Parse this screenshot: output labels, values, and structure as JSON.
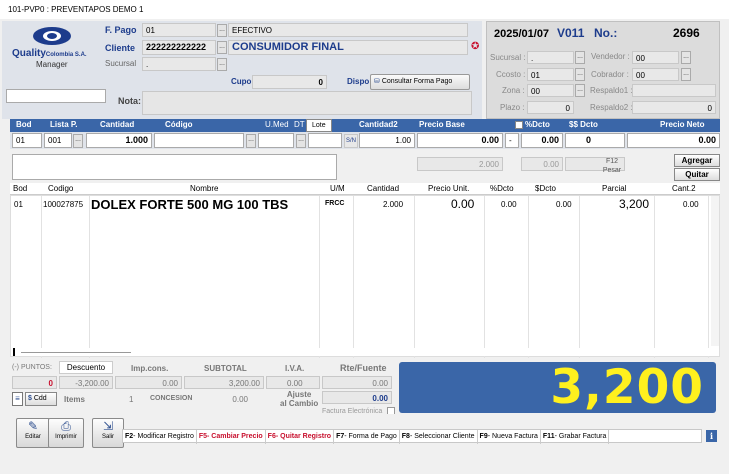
{
  "window": {
    "title": "101-PVP0 : PREVENTAPOS DEMO 1"
  },
  "logo": {
    "brand": "Quality",
    "suffix": "Colombia S.A.",
    "sub": "Manager"
  },
  "header": {
    "fpago_label": "F. Pago",
    "fpago_code": "01",
    "fpago_name": "EFECTIVO",
    "cliente_label": "Cliente",
    "cliente_code": "222222222222",
    "cliente_name": "CONSUMIDOR FINAL",
    "sucursal_label": "Sucursal",
    "sucursal_value": ".",
    "cupo_label": "Cupo",
    "cupo_value": "0",
    "dispo_label": "Dispo",
    "consultar_label": "Consultar Forma Pago",
    "nota_label": "Nota:"
  },
  "docinfo": {
    "date": "2025/01/07",
    "code": "V011",
    "no_label": "No.:",
    "number": "2696",
    "sucursal_label": "Sucursal :",
    "sucursal_value": ".",
    "vendedor_label": "Vendedor :",
    "vendedor_value": "00",
    "ccosto_label": "Ccosto :",
    "ccosto_value": "01",
    "cobrador_label": "Cobrador :",
    "cobrador_value": "00",
    "zona_label": "Zona :",
    "zona_value": "00",
    "respaldo1_label": "Respaldo1 :",
    "plazo_label": "Plazo :",
    "plazo_value": "0",
    "respaldo2_label": "Respaldo2 :",
    "respaldo2_value": "0"
  },
  "entry": {
    "headers": {
      "bod": "Bod",
      "lista": "Lista P.",
      "cantidad": "Cantidad",
      "codigo": "Código",
      "umed": "U.Med",
      "dt": "DT",
      "lote": "Lote",
      "cantidad2": "Cantidad2",
      "precio_base": "Precio Base",
      "pdcto": "%Dcto",
      "sdcto": "$$ Dcto",
      "precio_neto": "Precio Neto"
    },
    "bod": "01",
    "lista": "001",
    "cantidad": "1.000",
    "sn": "S/N",
    "cantidad2": "1.00",
    "precio_base": "0.00",
    "dash": "-",
    "pdcto": "0.00",
    "sdcto": "0",
    "precio_neto": "0.00",
    "sub_2000": "2.000",
    "sub_000": "0.00",
    "f12_label": "F12",
    "pesar_label": "Pesar",
    "agregar_label": "Agregar",
    "quitar_label": "Quitar"
  },
  "grid": {
    "columns": [
      "Bod",
      "Codigo",
      "Nombre",
      "U/M",
      "Cantidad",
      "Precio Unit.",
      "%Dcto",
      "$Dcto",
      "Parcial",
      "Cant.2"
    ],
    "rows": [
      {
        "bod": "01",
        "codigo": "100027875",
        "nombre": "DOLEX FORTE 500 MG 100 TBS",
        "um": "FRCC",
        "cantidad": "2.000",
        "precio": "0.00",
        "pdcto": "0.00",
        "sdcto": "0.00",
        "parcial": "3,200",
        "cant2": "0.00"
      }
    ]
  },
  "totals": {
    "puntos_label": "(-) PUNTOS:",
    "descuento_label": "Descuento",
    "impcons_label": "Imp.cons.",
    "subtotal_label": "SUBTOTAL",
    "iva_label": "I.V.A.",
    "rte_label": "Rte/Fuente",
    "puntos_value": "0",
    "descuento_value": "-3,200.00",
    "impcons_value": "0.00",
    "subtotal_value": "3,200.00",
    "iva_value": "0.00",
    "rte_value": "0.00",
    "cdd_label": "Cdd",
    "items_label": "Items",
    "items_value": "1",
    "concesion_label": "CONCESION",
    "concesion_value": "0.00",
    "ajuste_label": "Ajuste",
    "alcambio_label": "al Cambio",
    "ajuste_value": "0.00",
    "factura_label": "Factura Electrónica",
    "grand_total": "3,200"
  },
  "buttons": {
    "editar": "Editar",
    "imprimir": "Imprimir",
    "salir": "Salir"
  },
  "fkeys": [
    {
      "key": "F2",
      "label": " - Modificar Registro",
      "style": "k"
    },
    {
      "key": "F5",
      "label": " - Cambiar Precio",
      "style": "red"
    },
    {
      "key": "F6",
      "label": " - Quitar Registro",
      "style": "red"
    },
    {
      "key": "F7",
      "label": " - Forma de Pago",
      "style": "k"
    },
    {
      "key": "F8",
      "label": " - Seleccionar Cliente",
      "style": "k"
    },
    {
      "key": "F9",
      "label": " - Nueva Factura",
      "style": "k"
    },
    {
      "key": "F11",
      "label": " - Grabar Factura",
      "style": "k"
    }
  ],
  "colors": {
    "accent": "#3a66a8",
    "total": "#fff01e",
    "label_blue": "#1d3c8c",
    "red": "#c8102e"
  }
}
